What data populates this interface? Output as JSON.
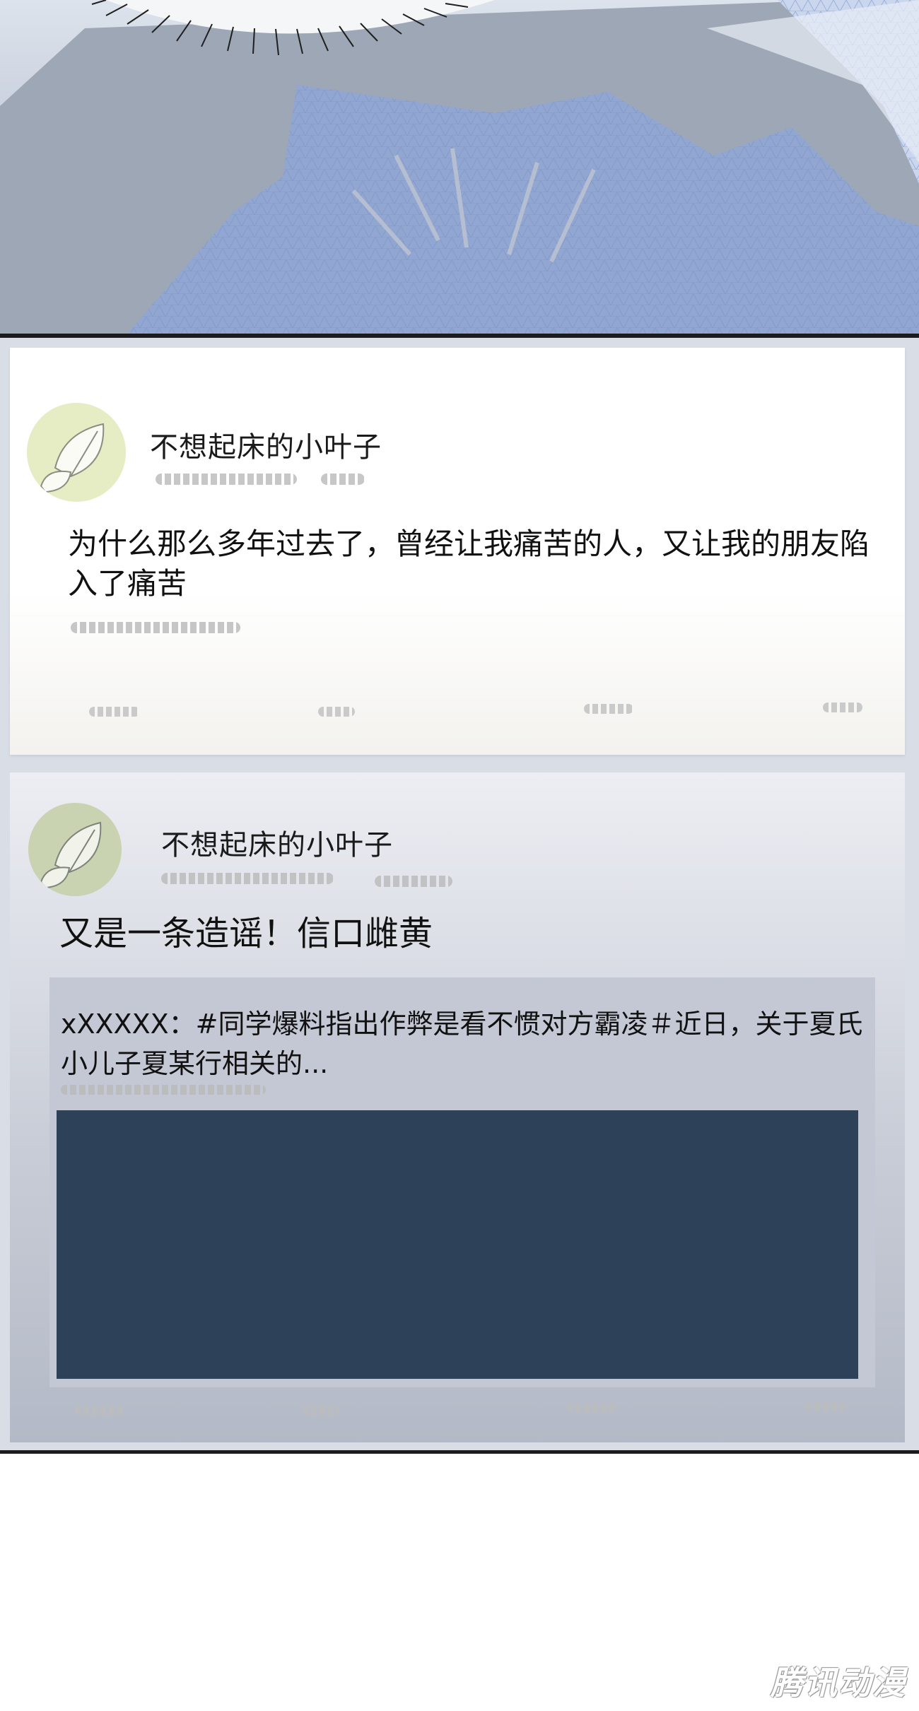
{
  "post_1": {
    "username": "不想起床的小叶子",
    "text": "为什么那么多年过去了，曾经让我痛苦的人，又让我的朋友陷入了痛苦"
  },
  "post_2": {
    "username": "不想起床的小叶子",
    "text": "又是一条造谣！信口雌黄",
    "repost": {
      "text": "xXXXXX：#同学爆料指出作弊是看不惯对方霸凌＃近日，关于夏氏小儿子夏某行相关的..."
    }
  },
  "watermark": "腾讯动漫",
  "colors": {
    "scene_blue": "#8ea6d6",
    "media_block": "#2d4159",
    "avatar_green": "#e6ecc4"
  }
}
